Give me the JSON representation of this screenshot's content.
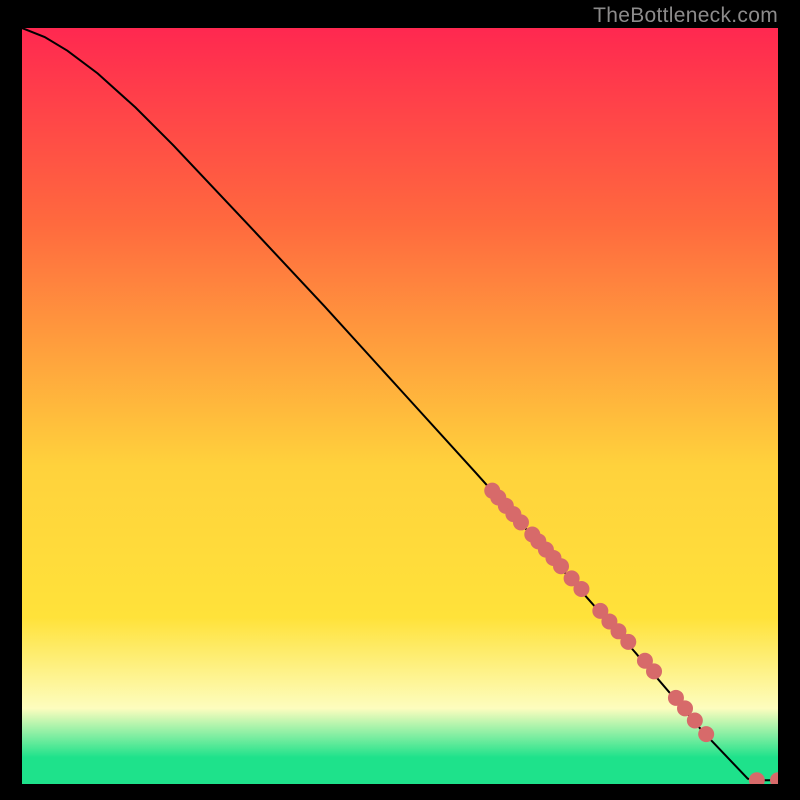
{
  "watermark": "TheBottleneck.com",
  "colors": {
    "gradient_top": "#ff2850",
    "gradient_upper": "#ff6a3e",
    "gradient_mid": "#ffd23c",
    "gradient_lower_yellow": "#ffe23a",
    "gradient_pale": "#fdfdbe",
    "gradient_green": "#1ee28b",
    "curve": "#000000",
    "marker_fill": "#d76a6a",
    "marker_stroke": "#c65a5a"
  },
  "chart_data": {
    "type": "line",
    "title": "",
    "xlabel": "",
    "ylabel": "",
    "xlim": [
      0,
      100
    ],
    "ylim": [
      0,
      100
    ],
    "grid": false,
    "legend": false,
    "series": [
      {
        "name": "curve",
        "kind": "line",
        "x": [
          0,
          3,
          6,
          10,
          15,
          20,
          30,
          40,
          50,
          60,
          70,
          80,
          90,
          96,
          97,
          98.5,
          100
        ],
        "y": [
          100,
          98.8,
          97.0,
          94.0,
          89.5,
          84.5,
          73.9,
          63.2,
          52.2,
          41.2,
          30.0,
          18.7,
          7.0,
          0.7,
          0.5,
          0.5,
          0.5
        ]
      },
      {
        "name": "dense-cluster",
        "kind": "scatter",
        "x": [
          62.2,
          63.0,
          64.0,
          65.0,
          66.0,
          67.5,
          68.3,
          69.3,
          70.3,
          71.3,
          72.7,
          74.0,
          76.5,
          77.7,
          78.9,
          80.2,
          82.4,
          83.6,
          86.5,
          87.7,
          89.0,
          90.5,
          97.2,
          100.0
        ],
        "y": [
          38.8,
          37.9,
          36.8,
          35.7,
          34.6,
          33.0,
          32.1,
          31.0,
          29.9,
          28.8,
          27.2,
          25.8,
          22.9,
          21.5,
          20.2,
          18.8,
          16.3,
          14.9,
          11.4,
          10.0,
          8.4,
          6.6,
          0.5,
          0.5
        ]
      }
    ]
  }
}
